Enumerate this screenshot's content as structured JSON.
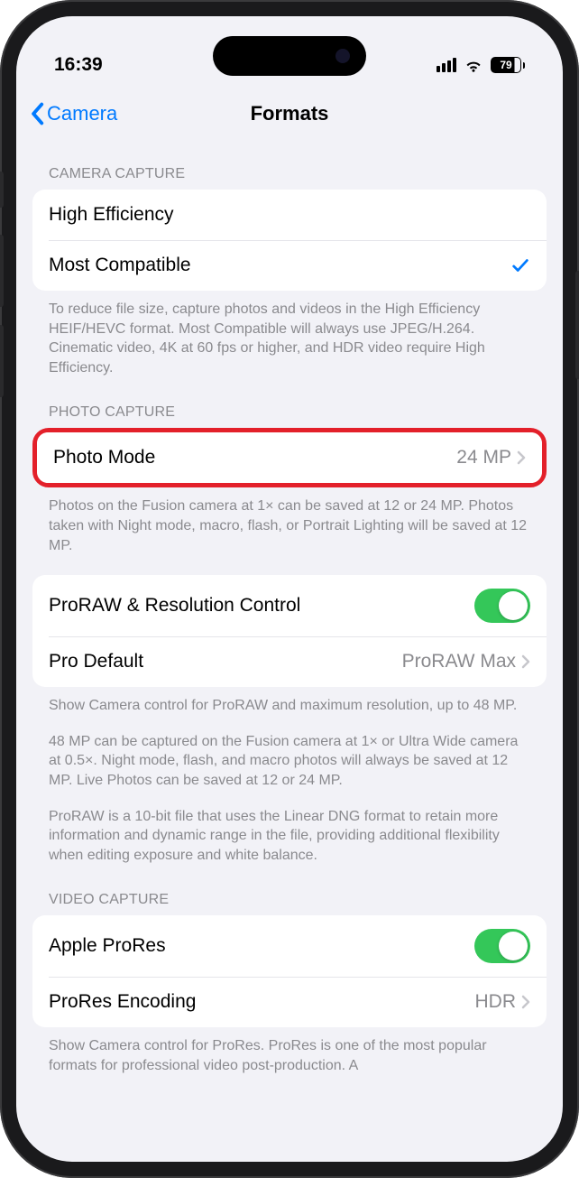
{
  "status": {
    "time": "16:39",
    "battery": "79"
  },
  "nav": {
    "back_label": "Camera",
    "title": "Formats"
  },
  "sections": {
    "camera_capture": {
      "header": "CAMERA CAPTURE",
      "high_efficiency": "High Efficiency",
      "most_compatible": "Most Compatible",
      "footer": "To reduce file size, capture photos and videos in the High Efficiency HEIF/HEVC format. Most Compatible will always use JPEG/H.264. Cinematic video, 4K at 60 fps or higher, and HDR video require High Efficiency."
    },
    "photo_capture": {
      "header": "PHOTO CAPTURE",
      "photo_mode_label": "Photo Mode",
      "photo_mode_value": "24 MP",
      "footer1": "Photos on the Fusion camera at 1× can be saved at 12 or 24 MP. Photos taken with Night mode, macro, flash, or Portrait Lighting will be saved at 12 MP.",
      "proraw_label": "ProRAW & Resolution Control",
      "pro_default_label": "Pro Default",
      "pro_default_value": "ProRAW Max",
      "footer2": "Show Camera control for ProRAW and maximum resolution, up to 48 MP.",
      "footer3": "48 MP can be captured on the Fusion camera at 1× or Ultra Wide camera at 0.5×. Night mode, flash, and macro photos will always be saved at 12 MP. Live Photos can be saved at 12 or 24 MP.",
      "footer4": "ProRAW is a 10-bit file that uses the Linear DNG format to retain more information and dynamic range in the file, providing additional flexibility when editing exposure and white balance."
    },
    "video_capture": {
      "header": "VIDEO CAPTURE",
      "apple_prores_label": "Apple ProRes",
      "prores_encoding_label": "ProRes Encoding",
      "prores_encoding_value": "HDR",
      "footer": "Show Camera control for ProRes. ProRes is one of the most popular formats for professional video post-production. A"
    }
  }
}
